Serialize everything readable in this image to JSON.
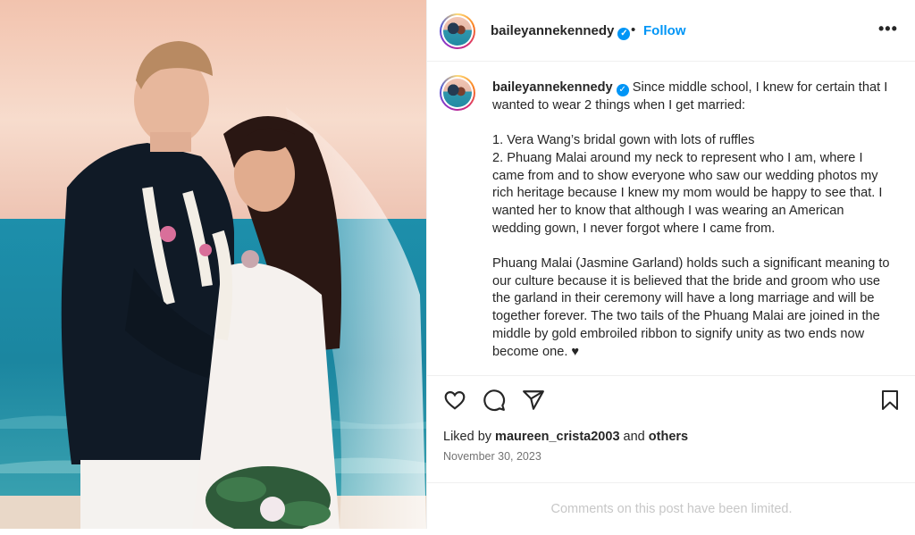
{
  "post": {
    "photo_alt": "",
    "username": "baileyannekennedy",
    "verified": true,
    "separator": "•",
    "follow_label": "Follow",
    "more_label": "•••",
    "caption": {
      "intro": "Since middle school, I knew for certain that I wanted to wear 2 things when I get married:",
      "item1": "1. Vera Wang’s bridal gown with lots of ruffles",
      "item2": "2. Phuang Malai around my neck to represent who I am, where I came from and to show everyone who saw our wedding photos my rich heritage because I knew my mom would be happy to see that. I wanted her to know that although I was wearing an American wedding gown, I never forgot where I came from.",
      "para2": "Phuang Malai (Jasmine Garland) holds such a significant meaning to our culture because it is believed that the bride and groom who use the garland in their ceremony will have a long marriage and will be together forever. The two tails of the Phuang Malai are joined in the middle by gold embroiled ribbon to signify unity as two ends now become one. ♥"
    },
    "likes": {
      "prefix": "Liked by",
      "user": "maureen_crista2003",
      "and": "and",
      "others": "others"
    },
    "date": "November 30, 2023",
    "comments_limited": "Comments on this post have been limited."
  },
  "icons": {
    "like": "heart-icon",
    "comment": "comment-icon",
    "share": "send-icon",
    "save": "bookmark-icon",
    "verified": "verified-badge-icon",
    "more": "more-options-icon"
  },
  "colors": {
    "accent": "#0095f6",
    "text": "#262626",
    "muted": "#737373",
    "limited": "#c7c7c7"
  }
}
